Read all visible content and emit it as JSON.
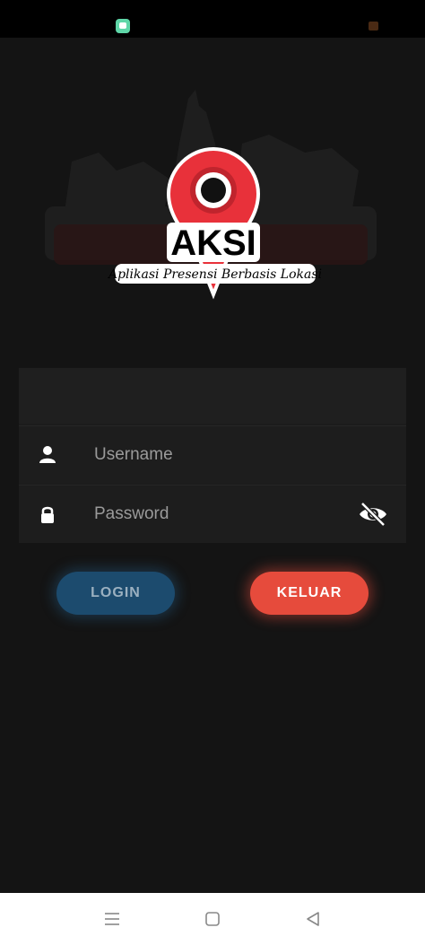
{
  "logo": {
    "title": "AKSI",
    "tagline": "Aplikasi Presensi Berbasis Lokasi"
  },
  "form": {
    "username_placeholder": "Username",
    "password_placeholder": "Password"
  },
  "buttons": {
    "login_label": "LOGIN",
    "exit_label": "KELUAR"
  },
  "colors": {
    "background": "#141414",
    "card": "#1c1c1c",
    "login_button": "#1c4b6e",
    "exit_button": "#e64b3c",
    "logo_pin": "#e8313a"
  },
  "icons": {
    "username": "user-icon",
    "password": "lock-icon",
    "toggle": "eye-off-icon",
    "nav": [
      "menu-icon",
      "home-square-icon",
      "back-triangle-icon"
    ]
  }
}
